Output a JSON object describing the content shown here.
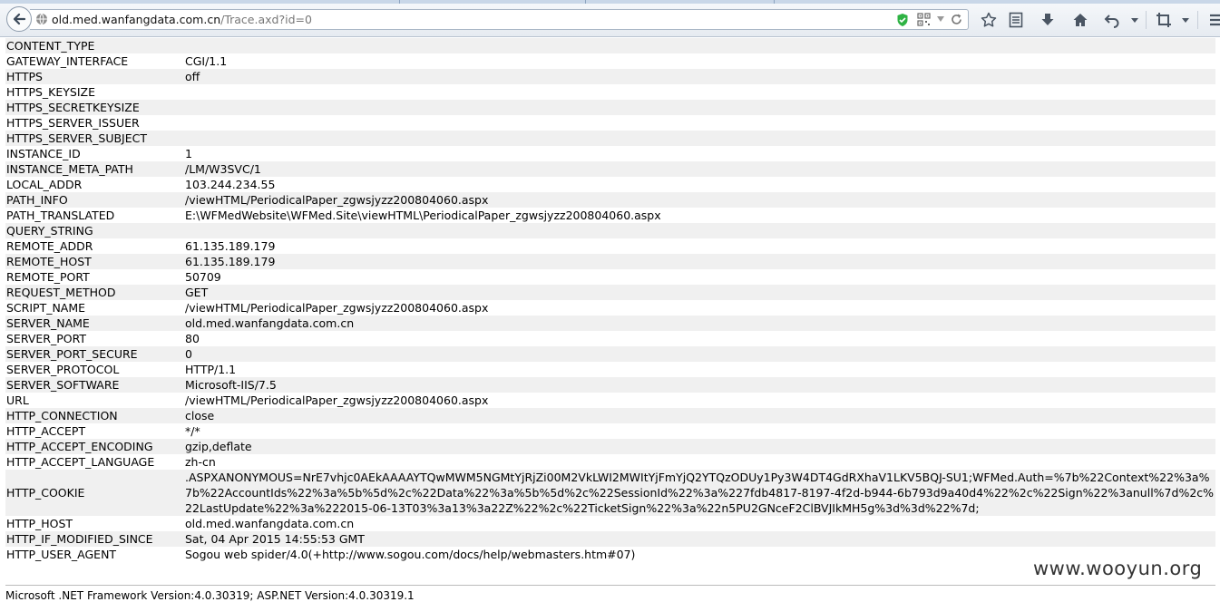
{
  "browser": {
    "url_domain": "old.med.wanfangdata.com.cn",
    "url_path": "/Trace.axd?id=0"
  },
  "server_variables": [
    {
      "name": "CONTENT_TYPE",
      "value": ""
    },
    {
      "name": "GATEWAY_INTERFACE",
      "value": "CGI/1.1"
    },
    {
      "name": "HTTPS",
      "value": "off"
    },
    {
      "name": "HTTPS_KEYSIZE",
      "value": ""
    },
    {
      "name": "HTTPS_SECRETKEYSIZE",
      "value": ""
    },
    {
      "name": "HTTPS_SERVER_ISSUER",
      "value": ""
    },
    {
      "name": "HTTPS_SERVER_SUBJECT",
      "value": ""
    },
    {
      "name": "INSTANCE_ID",
      "value": "1"
    },
    {
      "name": "INSTANCE_META_PATH",
      "value": "/LM/W3SVC/1"
    },
    {
      "name": "LOCAL_ADDR",
      "value": "103.244.234.55"
    },
    {
      "name": "PATH_INFO",
      "value": "/viewHTML/PeriodicalPaper_zgwsjyzz200804060.aspx"
    },
    {
      "name": "PATH_TRANSLATED",
      "value": "E:\\WFMedWebsite\\WFMed.Site\\viewHTML\\PeriodicalPaper_zgwsjyzz200804060.aspx"
    },
    {
      "name": "QUERY_STRING",
      "value": ""
    },
    {
      "name": "REMOTE_ADDR",
      "value": "61.135.189.179"
    },
    {
      "name": "REMOTE_HOST",
      "value": "61.135.189.179"
    },
    {
      "name": "REMOTE_PORT",
      "value": "50709"
    },
    {
      "name": "REQUEST_METHOD",
      "value": "GET"
    },
    {
      "name": "SCRIPT_NAME",
      "value": "/viewHTML/PeriodicalPaper_zgwsjyzz200804060.aspx"
    },
    {
      "name": "SERVER_NAME",
      "value": "old.med.wanfangdata.com.cn"
    },
    {
      "name": "SERVER_PORT",
      "value": "80"
    },
    {
      "name": "SERVER_PORT_SECURE",
      "value": "0"
    },
    {
      "name": "SERVER_PROTOCOL",
      "value": "HTTP/1.1"
    },
    {
      "name": "SERVER_SOFTWARE",
      "value": "Microsoft-IIS/7.5"
    },
    {
      "name": "URL",
      "value": "/viewHTML/PeriodicalPaper_zgwsjyzz200804060.aspx"
    },
    {
      "name": "HTTP_CONNECTION",
      "value": "close"
    },
    {
      "name": "HTTP_ACCEPT",
      "value": "*/*"
    },
    {
      "name": "HTTP_ACCEPT_ENCODING",
      "value": "gzip,deflate"
    },
    {
      "name": "HTTP_ACCEPT_LANGUAGE",
      "value": "zh-cn"
    },
    {
      "name": "HTTP_COOKIE",
      "value": ".ASPXANONYMOUS=NrE7vhjc0AEkAAAAYTQwMWM5NGMtYjRjZi00M2VkLWI2MWItYjFmYjQ2YTQzODUy1Py3W4DT4GdRXhaV1LKV5BQJ-SU1;WFMed.Auth=%7b%22Context%22%3a%7b%22AccountIds%22%3a%5b%5d%2c%22Data%22%3a%5b%5d%2c%22SessionId%22%3a%227fdb4817-8197-4f2d-b944-6b793d9a40d4%22%2c%22Sign%22%3anull%7d%2c%22LastUpdate%22%3a%222015-06-13T03%3a13%3a22Z%22%2c%22TicketSign%22%3a%22n5PU2GNceF2ClBVJIkMH5g%3d%3d%22%7d;",
      "wrap": true
    },
    {
      "name": "HTTP_HOST",
      "value": "old.med.wanfangdata.com.cn"
    },
    {
      "name": "HTTP_IF_MODIFIED_SINCE",
      "value": "Sat, 04 Apr 2015 14:55:53 GMT"
    },
    {
      "name": "HTTP_USER_AGENT",
      "value": "Sogou web spider/4.0(+http://www.sogou.com/docs/help/webmasters.htm#07)"
    }
  ],
  "footer": {
    "version_text": "Microsoft .NET Framework Version:4.0.30319; ASP.NET Version:4.0.30319.1"
  },
  "watermark": "www.wooyun.org"
}
